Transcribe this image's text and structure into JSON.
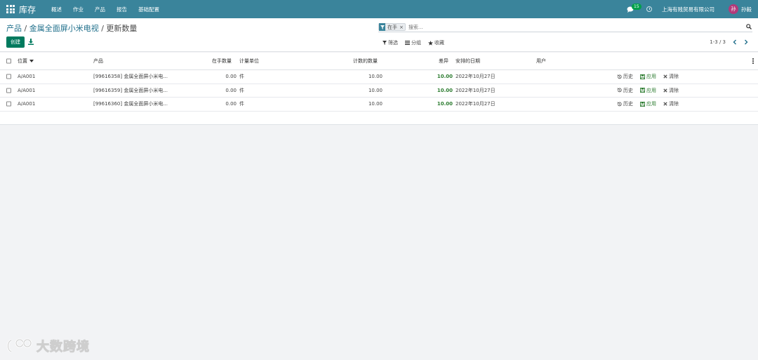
{
  "topbar": {
    "app_title": "库存",
    "menu": [
      "概述",
      "作业",
      "产品",
      "报告",
      "基础配置"
    ],
    "chat_count": "15",
    "company": "上海有贱贸易有限公司",
    "avatar_initial": "孙",
    "user_name": "孙毅",
    "color": "#3a849b"
  },
  "breadcrumb": {
    "root": "产品",
    "separator": " / ",
    "parent": "金属全面屏小米电视",
    "current": "更新数量"
  },
  "search": {
    "facet_label": "在手",
    "placeholder": "搜索..."
  },
  "toolbar": {
    "create_label": "创建",
    "filter_label": "筛选",
    "group_label": "分组",
    "favorite_label": "收藏",
    "pager": "1-3 / 3",
    "create_color": "#007a5e"
  },
  "table": {
    "headers": {
      "location": "位置",
      "product": "产品",
      "on_hand": "在手数量",
      "uom": "计量单位",
      "counted": "计数的数量",
      "difference": "差异",
      "scheduled": "安排的日期",
      "user": "用户"
    },
    "rows": [
      {
        "location": "A/A001",
        "product": "[99616358] 金属全面屏小米电...",
        "on_hand": "0.00",
        "uom": "件",
        "counted": "10.00",
        "difference": "10.00",
        "scheduled": "2022年10月27日",
        "history": "历史",
        "apply": "应用",
        "clear": "清除"
      },
      {
        "location": "A/A001",
        "product": "[99616359] 金属全面屏小米电...",
        "on_hand": "0.00",
        "uom": "件",
        "counted": "10.00",
        "difference": "10.00",
        "scheduled": "2022年10月27日",
        "history": "历史",
        "apply": "应用",
        "clear": "清除"
      },
      {
        "location": "A/A001",
        "product": "[99616360] 金属全面屏小米电...",
        "on_hand": "0.00",
        "uom": "件",
        "counted": "10.00",
        "difference": "10.00",
        "scheduled": "2022年10月27日",
        "history": "历史",
        "apply": "应用",
        "clear": "清除"
      }
    ]
  },
  "watermark": {
    "text": "大数跨境"
  }
}
